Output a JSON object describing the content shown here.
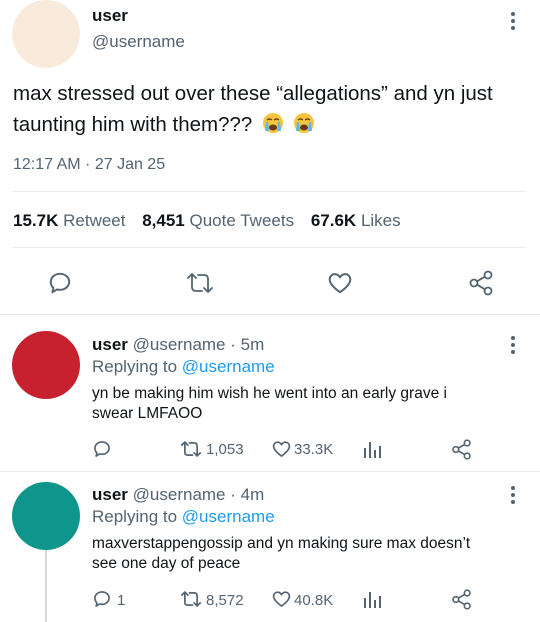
{
  "main_tweet": {
    "display_name": "user",
    "handle": "@username",
    "text": "max stressed out over these “allegations” and yn just taunting him with them???",
    "emojis": [
      "loudly-crying-face",
      "loudly-crying-face"
    ],
    "timestamp": "12:17 AM · 27 Jan 25",
    "stats": {
      "retweets_count": "15.7K",
      "retweets_label": "Retweet",
      "quotes_count": "8,451",
      "quotes_label": "Quote Tweets",
      "likes_count": "67.6K",
      "likes_label": "Likes"
    },
    "avatar_color": "#f9ebdc"
  },
  "replies": [
    {
      "display_name": "user",
      "handle": "@username",
      "time": "· 5m",
      "replying_prefix": "Replying to",
      "replying_handle": "@username",
      "text_line1": "yn be making him wish he went into an early grave i",
      "text_line2": "swear LMFAOO",
      "reply_count": "",
      "retweet_count": "1,053",
      "like_count": "33.3K",
      "avatar_color": "#c7202e"
    },
    {
      "display_name": "user",
      "handle": "@username",
      "time": "· 4m",
      "replying_prefix": "Replying to",
      "replying_handle": "@username",
      "text_line1": "maxverstappengossip and yn making sure max doesn’t",
      "text_line2": "see one day of peace",
      "reply_count": "1",
      "retweet_count": "8,572",
      "like_count": "40.8K",
      "avatar_color": "#0f968c"
    }
  ],
  "colors": {
    "text": "#0f1419",
    "secondary": "#536471",
    "link": "#1d9bf0",
    "divider": "#e6ecf0"
  }
}
